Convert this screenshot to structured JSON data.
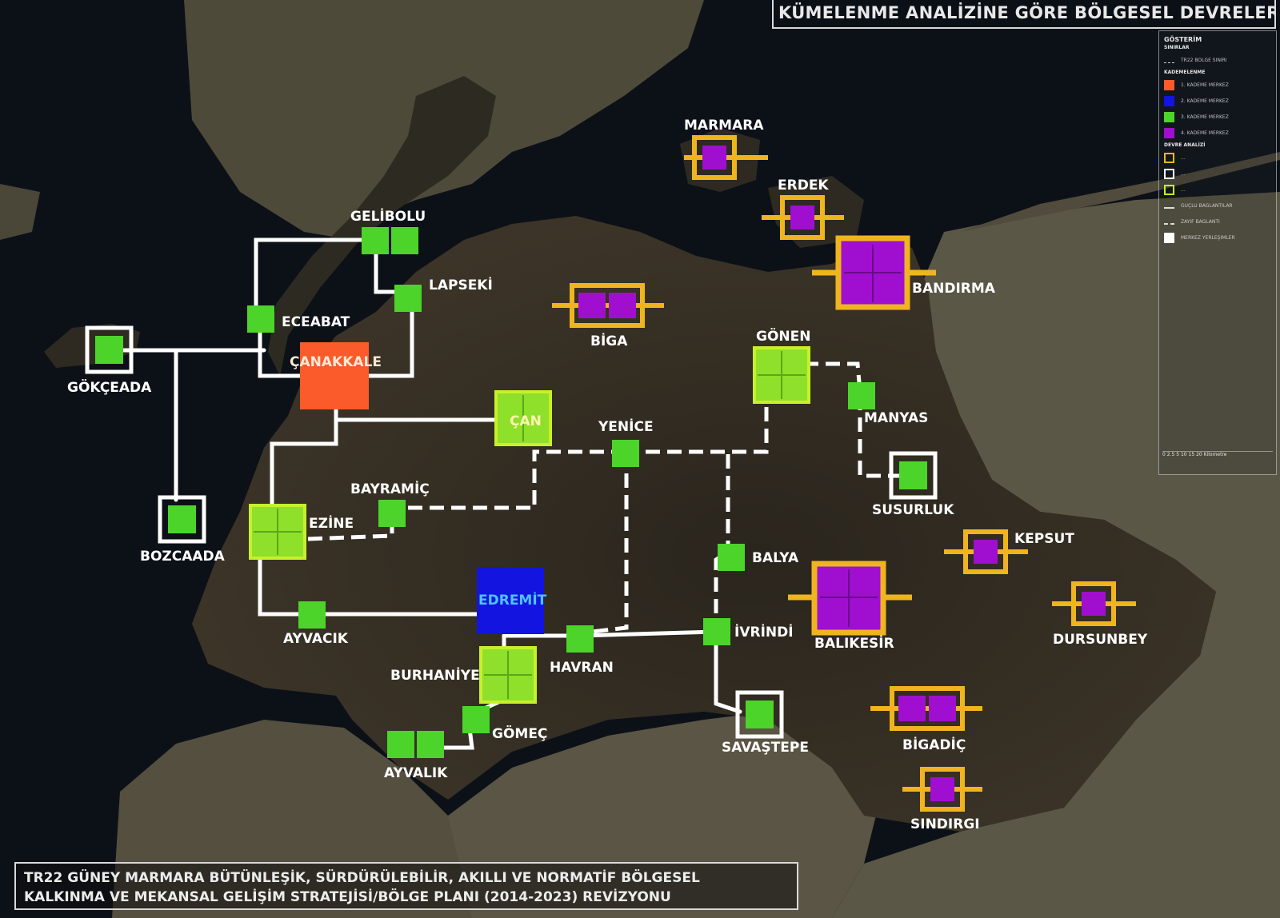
{
  "title": "KÜMELENME ANALİZİNE GÖRE BÖLGESEL DEVRELER",
  "footer": {
    "line1": "TR22 GÜNEY MARMARA BÜTÜNLEŞİK, SÜRDÜRÜLEBİLİR, AKILLI VE NORMATİF BÖLGESEL",
    "line2": "KALKINMA VE MEKANSAL GELİŞİM STRATEJİSİ/BÖLGE PLANI (2014-2023) REVİZYONU"
  },
  "colors": {
    "sea": "#0c1118",
    "land_dark": "#2f2a22",
    "land_light": "#5e5a47",
    "center_1": "#fb5a2a",
    "center_2": "#1414e0",
    "center_3": "#4cd42a",
    "center_3_large": "#8ee02a",
    "center_4": "#a00fd0",
    "ring_yellow": "#f0b51e",
    "ring_white": "#ffffff",
    "ring_green": "#c8f02a"
  },
  "legend": {
    "heading": "GÖSTERİM",
    "boundaries": "SINIRLAR",
    "boundary_item": "TR22 BÖLGE SINIRI",
    "hierarchy": "KADEMELENME",
    "levels": [
      "1. KADEME MERKEZ",
      "2. KADEME MERKEZ",
      "3. KADEME MERKEZ",
      "4. KADEME MERKEZ"
    ],
    "circuits": "DEVRE ANALİZİ",
    "circuit_items": [
      "...",
      "...",
      "..."
    ],
    "links": [
      "GÜÇLÜ BAĞLANTILAR",
      "ZAYIF BAĞLANTI"
    ],
    "other": "MERKEZ YERLEŞİMLER",
    "scale": [
      "0 2.5",
      "5",
      "10",
      "15",
      "20",
      "Kilometre"
    ]
  },
  "places": {
    "marmara": "MARMARA",
    "erdek": "ERDEK",
    "bandirma": "BANDIRMA",
    "biga": "BİGA",
    "gelibolu": "GELİBOLU",
    "lapseki": "LAPSEKİ",
    "eceabat": "ECEABAT",
    "canakkale": "ÇANAKKALE",
    "gokceada": "GÖKÇEADA",
    "bozcaada": "BOZCAADA",
    "can": "ÇAN",
    "yenice": "YENİCE",
    "gonen": "GÖNEN",
    "manyas": "MANYAS",
    "susurluk": "SUSURLUK",
    "bayramic": "BAYRAMİÇ",
    "ezine": "EZİNE",
    "balya": "BALYA",
    "edremit": "EDREMİT",
    "ayvacik": "AYVACIK",
    "havran": "HAVRAN",
    "ivrindi": "İVRİNDİ",
    "burhaniye": "BURHANİYE",
    "gomec": "GÖMEÇ",
    "ayvalik": "AYVALIK",
    "savastepe": "SAVAŞTEPE",
    "balikesir": "BALIKESİR",
    "kepsut": "KEPSUT",
    "dursunbey": "DURSUNBEY",
    "bigadic": "BİGADİÇ",
    "sindirgi": "SINDIRGI"
  }
}
